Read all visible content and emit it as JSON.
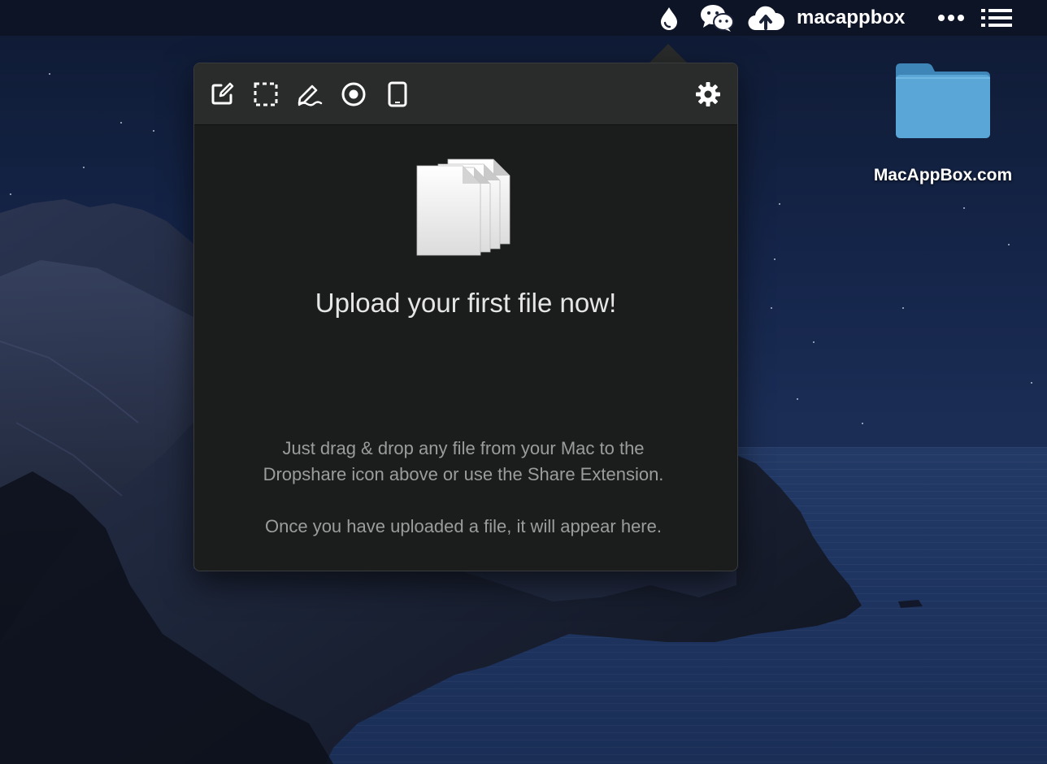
{
  "menubar": {
    "icons": [
      "dropshare-droplet-icon",
      "wechat-icon",
      "cloud-upload-icon",
      "ellipsis-icon",
      "list-icon"
    ],
    "username": "macappbox"
  },
  "desktop": {
    "folder_label": "MacAppBox.com",
    "folder_icon": "folder-icon"
  },
  "popover": {
    "toolbar": {
      "icons": [
        "compose-icon",
        "screen-capture-icon",
        "sketch-icon",
        "screen-record-icon",
        "device-icon",
        "gear-icon"
      ]
    },
    "headline": "Upload your first file now!",
    "description_line1": "Just drag & drop any file from your Mac to the",
    "description_line2": "Dropshare icon above or use the Share Extension.",
    "description_line3": "Once you have uploaded a file, it will appear here."
  },
  "colors": {
    "popover_bg": "#1b1c1c",
    "toolbar_bg": "#2a2b2b",
    "folder_blue": "#5aa6d6",
    "headline_text": "#e6e6e6",
    "desc_text": "#9b9c9c"
  }
}
